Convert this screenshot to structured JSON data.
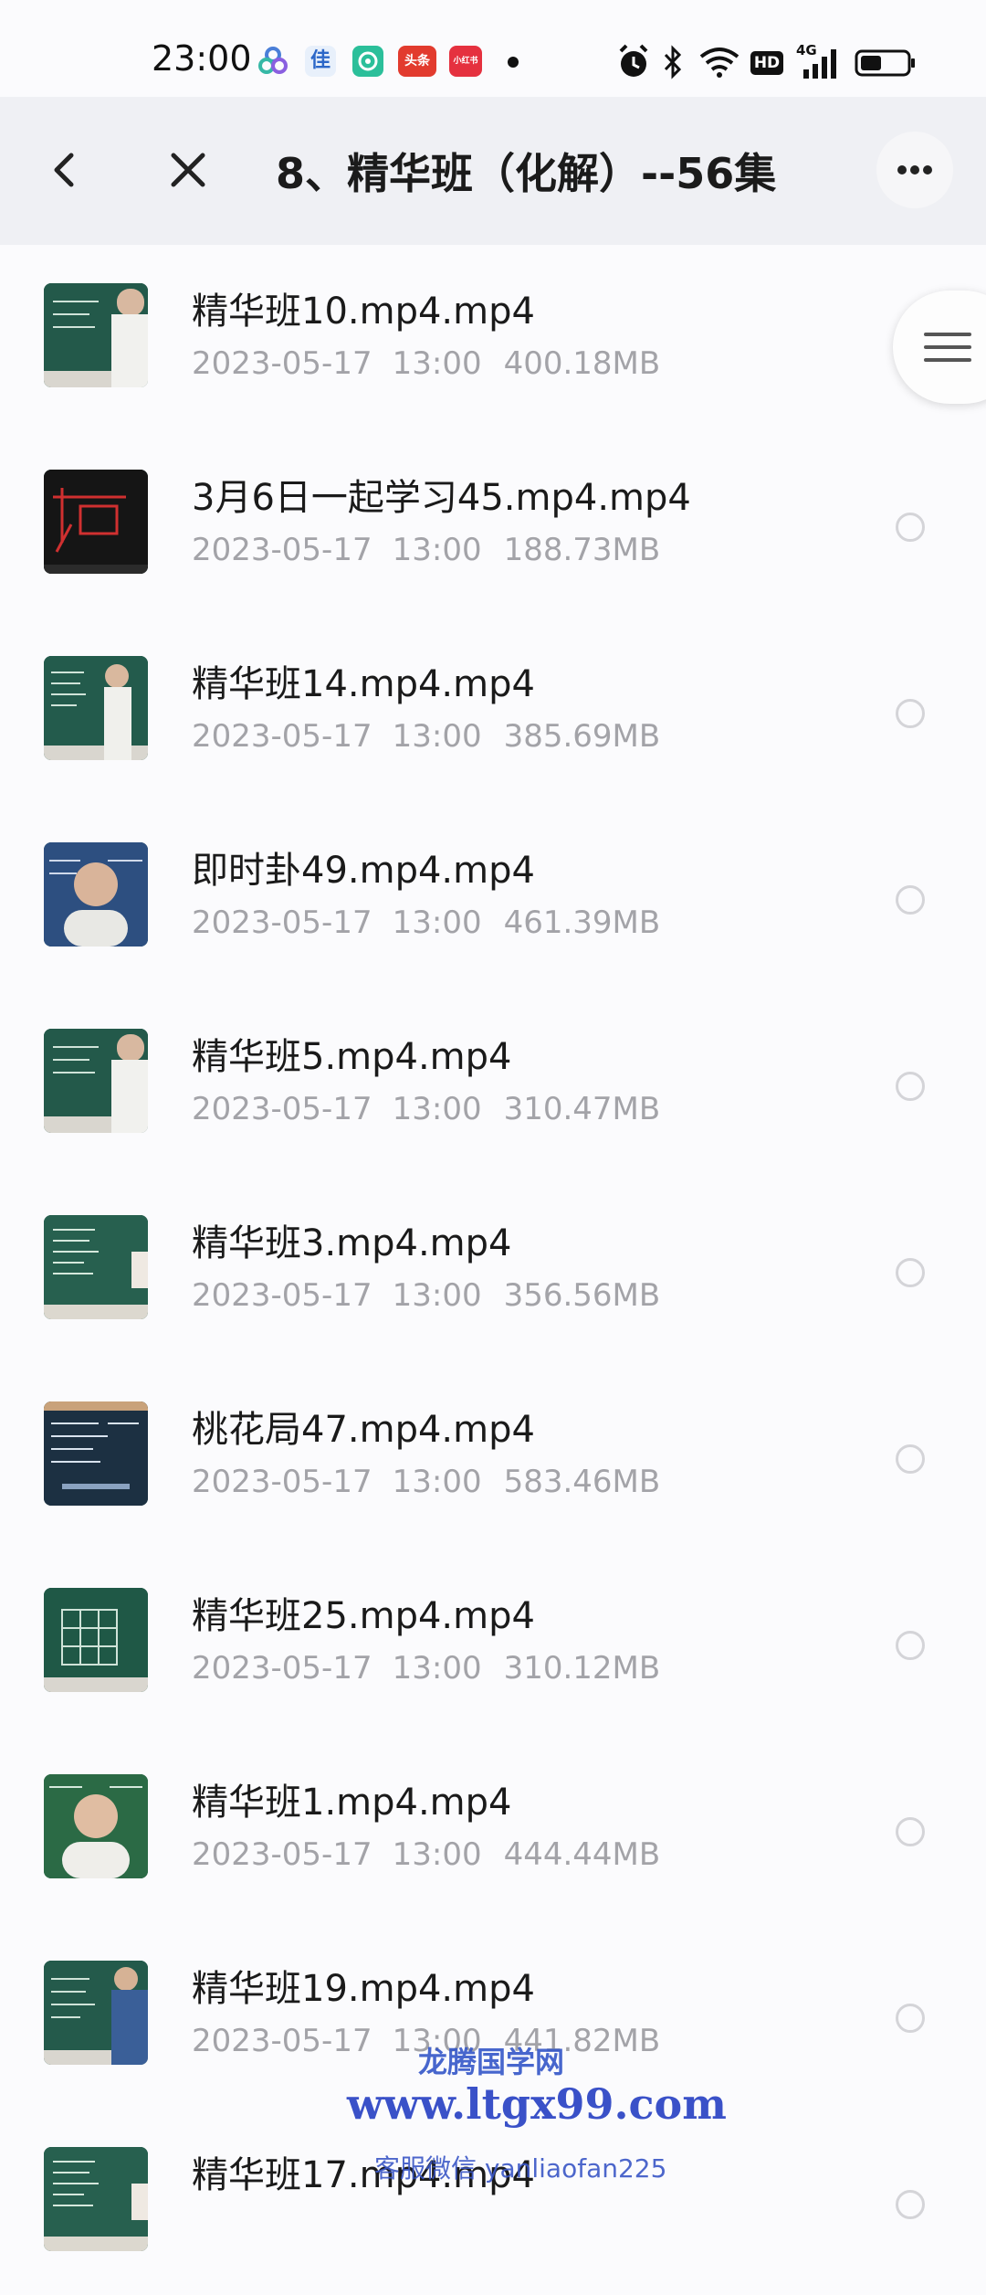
{
  "status_bar": {
    "time": "23:00",
    "app_icons": [
      {
        "icon": "flower-app-icon",
        "color": "#4a7fd8"
      },
      {
        "icon": "jia-app-icon",
        "color": "#2c67c8",
        "label": "佳"
      },
      {
        "icon": "chat-app-icon",
        "color": "#2bbf9a"
      },
      {
        "icon": "toutiao-app-icon",
        "color": "#e23b2e",
        "label": "头条"
      },
      {
        "icon": "xiaohongshu-app-icon",
        "color": "#e5313f",
        "label": "小红书"
      }
    ],
    "right_icons": [
      "alarm-icon",
      "bluetooth-icon",
      "wifi-icon",
      "hd-icon",
      "4g-signal-icon",
      "battery-icon"
    ],
    "hd_label": "HD",
    "network_label": "4G"
  },
  "header": {
    "title": "8、精华班（化解）--56集"
  },
  "files": [
    {
      "name": "精华班10.mp4.mp4",
      "date": "2023-05-17",
      "time": "13:00",
      "size": "400.18MB",
      "thumb": "blackboard-teacher-right"
    },
    {
      "name": "3月6日一起学习45.mp4.mp4",
      "date": "2023-05-17",
      "time": "13:00",
      "size": "188.73MB",
      "thumb": "dark-red-diagram"
    },
    {
      "name": "精华班14.mp4.mp4",
      "date": "2023-05-17",
      "time": "13:00",
      "size": "385.69MB",
      "thumb": "blackboard-teacher-center"
    },
    {
      "name": "即时卦49.mp4.mp4",
      "date": "2023-05-17",
      "time": "13:00",
      "size": "461.39MB",
      "thumb": "teacher-closeup-blue"
    },
    {
      "name": "精华班5.mp4.mp4",
      "date": "2023-05-17",
      "time": "13:00",
      "size": "310.47MB",
      "thumb": "blackboard-teacher-right"
    },
    {
      "name": "精华班3.mp4.mp4",
      "date": "2023-05-17",
      "time": "13:00",
      "size": "356.56MB",
      "thumb": "blackboard-writing"
    },
    {
      "name": "桃花局47.mp4.mp4",
      "date": "2023-05-17",
      "time": "13:00",
      "size": "583.46MB",
      "thumb": "blackboard-dark-blue"
    },
    {
      "name": "精华班25.mp4.mp4",
      "date": "2023-05-17",
      "time": "13:00",
      "size": "310.12MB",
      "thumb": "blackboard-grid"
    },
    {
      "name": "精华班1.mp4.mp4",
      "date": "2023-05-17",
      "time": "13:00",
      "size": "444.44MB",
      "thumb": "teacher-closeup-green"
    },
    {
      "name": "精华班19.mp4.mp4",
      "date": "2023-05-17",
      "time": "13:00",
      "size": "441.82MB",
      "thumb": "blackboard-teacher-right-blue"
    },
    {
      "name": "精华班17.mp4.mp4",
      "date": "",
      "time": "",
      "size": "",
      "thumb": "blackboard-writing"
    }
  ],
  "watermark": {
    "line1": "龙腾国学网",
    "line2": "www.ltgx99.com",
    "line3": "客服微信 yanliaofan225"
  },
  "colors": {
    "header_bg": "#eff0f4",
    "list_bg": "#fbfbfd",
    "meta_text": "#a3a3a8",
    "watermark": "#2a43c4"
  }
}
